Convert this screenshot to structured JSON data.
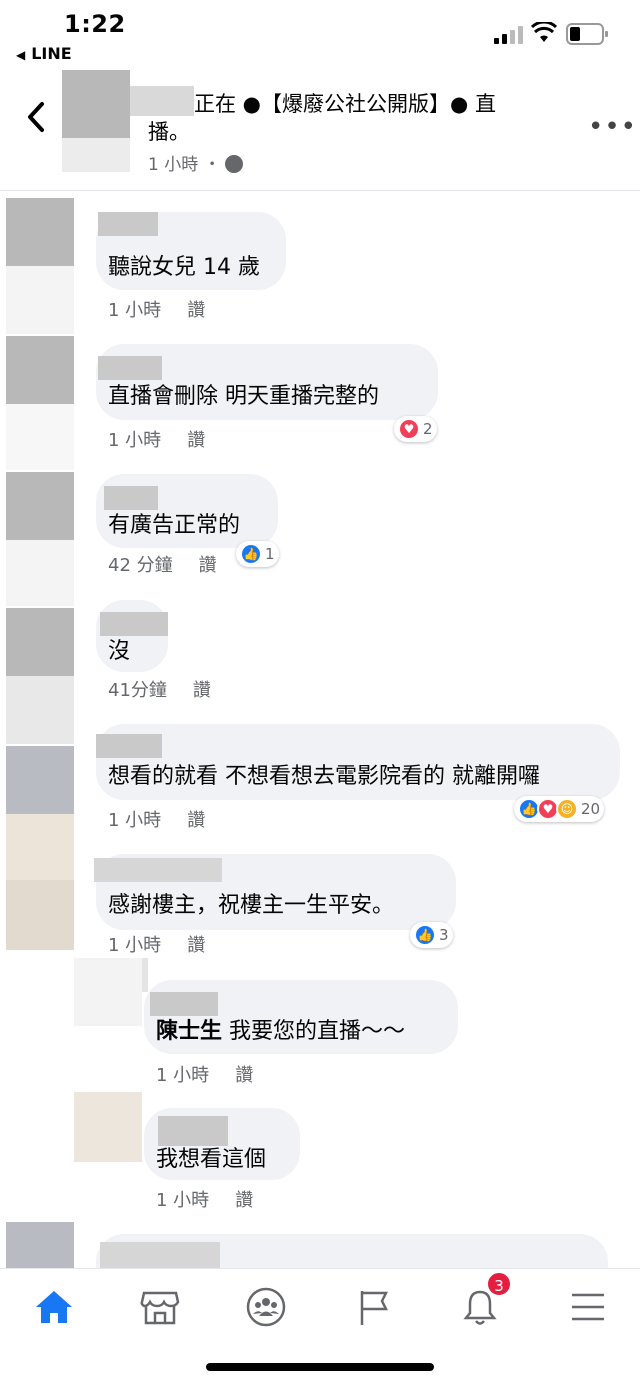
{
  "status_bar": {
    "time": "1:22",
    "back_app": "LINE"
  },
  "post": {
    "title": "正在 ●【爆廢公社公開版】● 直播。",
    "time": "1 小時 ・"
  },
  "comments": [
    {
      "text": "聽說女兒 14 歲",
      "time": "1 小時",
      "like": "讚"
    },
    {
      "text": "直播會刪除 明天重播完整的",
      "time": "1 小時",
      "like": "讚",
      "reaction_count": "2"
    },
    {
      "text": "有廣告正常的",
      "time": "42 分鐘",
      "like": "讚",
      "reaction_count": "1"
    },
    {
      "text": "沒",
      "time": "41分鐘",
      "like": "讚"
    },
    {
      "text": "想看的就看 不想看想去電影院看的 就離開囉",
      "time": "1 小時",
      "like": "讚",
      "reaction_count": "20"
    },
    {
      "text": "感謝樓主，祝樓主一生平安。",
      "time": "1 小時",
      "like": "讚",
      "reaction_count": "3"
    }
  ],
  "replies": [
    {
      "mention": "陳士生",
      "text": " 我要您的直播～～",
      "time": "1 小時",
      "like": "讚"
    },
    {
      "text": "我想看這個",
      "time": "1 小時",
      "like": "讚"
    }
  ],
  "nav": {
    "notifications_badge": "3"
  },
  "colors": {
    "accent": "#1877f2",
    "love": "#f33e58",
    "badge": "#e41e3f",
    "bubble": "#f0f2f5"
  }
}
